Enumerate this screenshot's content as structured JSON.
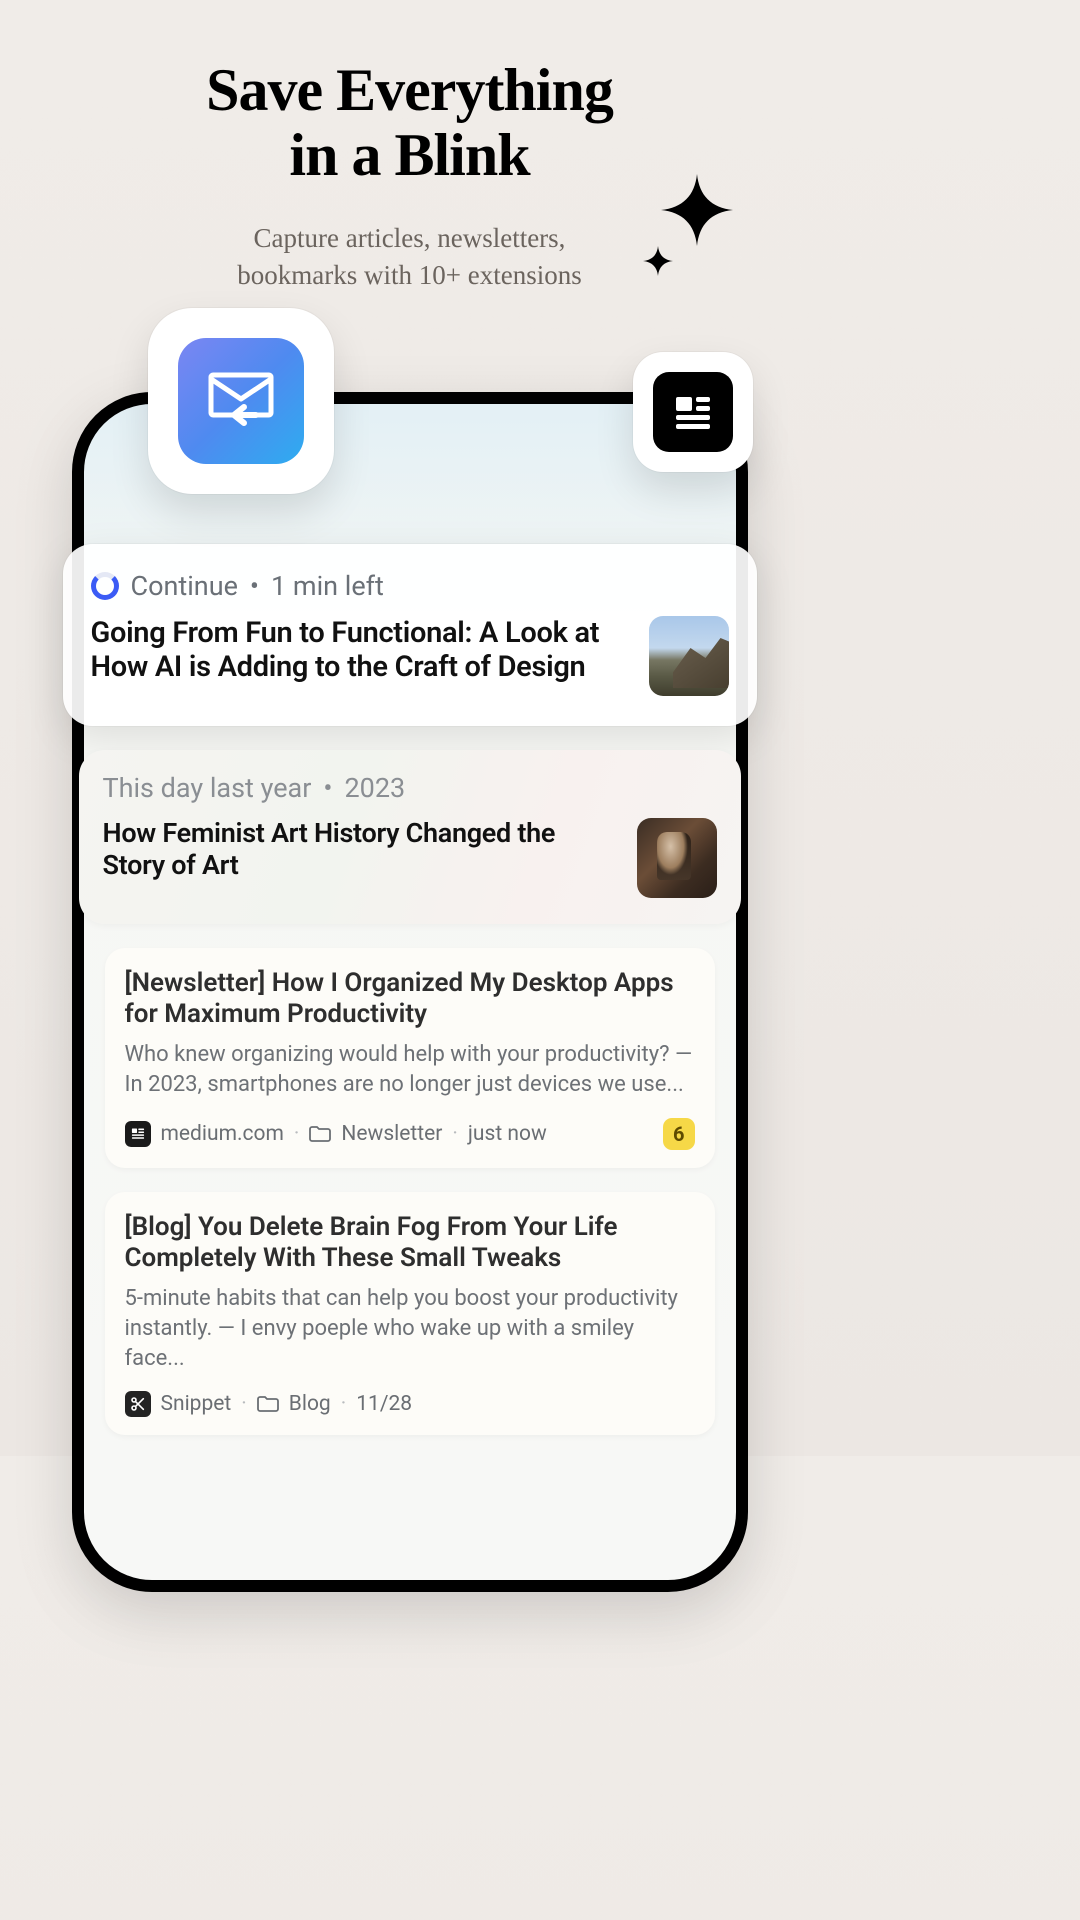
{
  "hero": {
    "title_line1": "Save Everything",
    "title_line2": "in a Blink",
    "sub_line1": "Capture articles, newsletters,",
    "sub_line2": "bookmarks with 10+ extensions"
  },
  "cards": {
    "continue": {
      "label": "Continue",
      "time_left": "1 min left",
      "sep": "•",
      "title": "Going From Fun to Functional: A Look at How AI is Adding to the Craft of Design"
    },
    "memory": {
      "label": "This day last year",
      "year": "2023",
      "sep": "•",
      "title": "How Feminist Art History Changed the Story of Art"
    },
    "article1": {
      "title": "[Newsletter] How I Organized My Desktop Apps for Maximum Productivity",
      "excerpt": "Who knew organizing would help with your productivity? — In 2023, smartphones are no longer just devices we use...",
      "source": "medium.com",
      "folder": "Newsletter",
      "time": "just now",
      "count": "6"
    },
    "article2": {
      "title": "[Blog] You Delete Brain Fog From Your Life Completely With These Small Tweaks",
      "excerpt": "5-minute habits that can help you boost your productivity instantly. — I envy poeple who wake up with a smiley face...",
      "source": "Snippet",
      "folder": "Blog",
      "date": "11/28"
    }
  }
}
